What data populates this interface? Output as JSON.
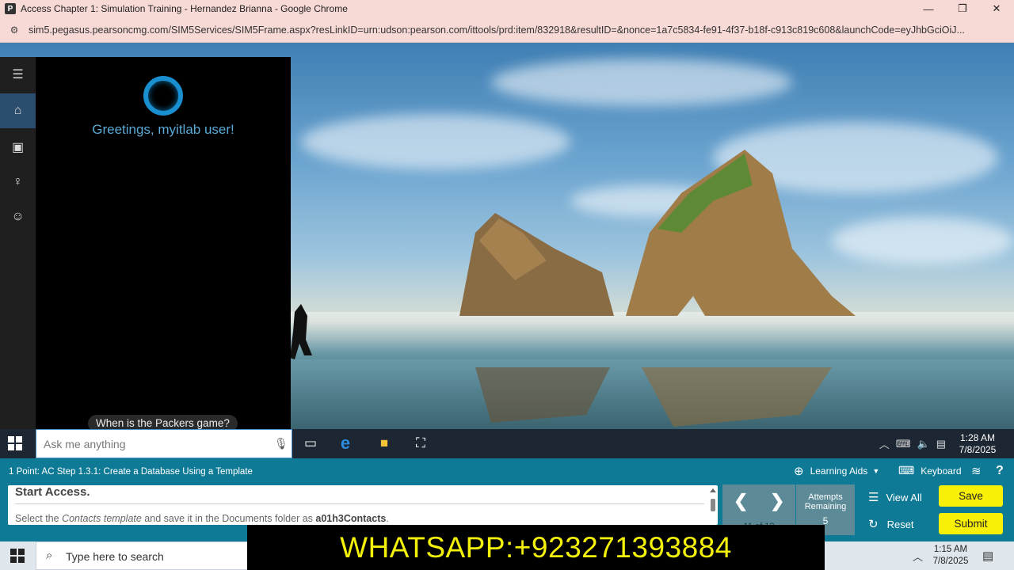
{
  "browser": {
    "window_title": "Access Chapter 1: Simulation Training - Hernandez Brianna - Google Chrome",
    "url": "sim5.pegasus.pearsoncmg.com/SIM5Services/SIM5Frame.aspx?resLinkID=urn:udson:pearson.com/ittools/prd:item/832918&resultID=&nonce=1a7c5834-fe91-4f37-b18f-c913c819c608&launchCode=eyJhbGciOiJ...",
    "minimize": "—",
    "restore": "❐",
    "close": "✕"
  },
  "cortana": {
    "greeting": "Greetings, myitlab user!",
    "suggestion": "When is the Packers game?",
    "search_placeholder": "Ask me anything"
  },
  "taskbar": {
    "time": "1:28 AM",
    "date": "7/8/2025"
  },
  "sim": {
    "step_title": "1 Point: AC Step 1.3.1: Create a Database Using a Template",
    "learning_aids": "Learning Aids",
    "keyboard": "Keyboard",
    "help": "?",
    "task_heading": "Start Access.",
    "task_text_1": "Select the ",
    "task_text_em": "Contacts template",
    "task_text_2": " and save it in the Documents folder as ",
    "task_text_strong": "a01h3Contacts",
    "task_text_3": ".",
    "step_counter": "11 of 12",
    "attempts_label": "Attempts Remaining",
    "attempts_value": "5",
    "view_all": "View All",
    "reset": "Reset",
    "save": "Save",
    "submit": "Submit"
  },
  "host_taskbar": {
    "search_placeholder": "Type here to search",
    "time": "1:15 AM",
    "date": "7/8/2025"
  },
  "banner": {
    "text": "WHATSAPP:+923271393884"
  }
}
